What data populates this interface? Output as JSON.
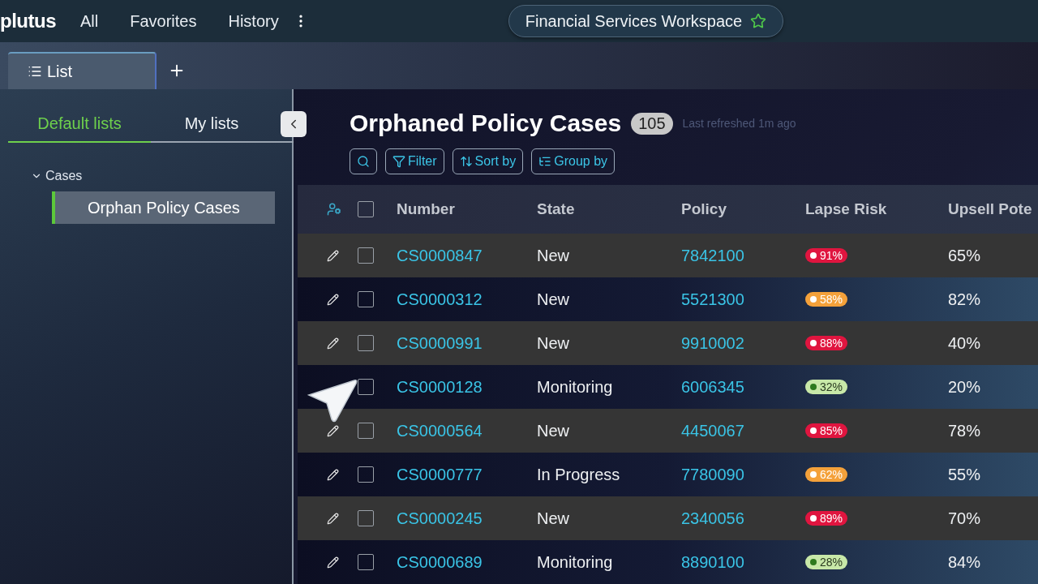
{
  "top_bar": {
    "logo": "plutus",
    "nav": [
      {
        "label": "All"
      },
      {
        "label": "Favorites"
      },
      {
        "label": "History"
      }
    ],
    "workspace": {
      "title": "Financial Services Workspace",
      "favorite": true
    }
  },
  "tabs": [
    {
      "label": "List",
      "selected": true
    }
  ],
  "sidebar": {
    "tabs": [
      {
        "label": "Default lists",
        "selected": true
      },
      {
        "label": "My lists",
        "selected": false
      }
    ],
    "tree": [
      {
        "label": "Cases",
        "expanded": true,
        "selected": false,
        "children": [
          {
            "label": "Orphan Policy Cases",
            "selected": true
          }
        ]
      }
    ]
  },
  "list": {
    "title": "Orphaned Policy Cases",
    "count": "105",
    "refreshed": "Last refreshed 1m ago",
    "toolbar": [
      {
        "kind": "search"
      },
      {
        "kind": "filter",
        "label": "Filter"
      },
      {
        "kind": "sort",
        "label": "Sort by"
      },
      {
        "kind": "group",
        "label": "Group by"
      }
    ]
  },
  "table": {
    "columns": [
      "Number",
      "State",
      "Policy",
      "Lapse Risk",
      "Upsell Pote"
    ],
    "all_checked": false,
    "rows": [
      {
        "number": "CS0000847",
        "state": "New",
        "policy": "7842100",
        "risk": {
          "text": "91%",
          "color": "#e0153f"
        },
        "upsell": "65%",
        "checked": false,
        "edit_icon": true
      },
      {
        "number": "CS0000312",
        "state": "New",
        "policy": "5521300",
        "risk": {
          "text": "58%",
          "color": "#f4a13a"
        },
        "upsell": "82%",
        "checked": false,
        "edit_icon": true
      },
      {
        "number": "CS0000991",
        "state": "New",
        "policy": "9910002",
        "risk": {
          "text": "88%",
          "color": "#e0153f"
        },
        "upsell": "40%",
        "checked": false,
        "edit_icon": true
      },
      {
        "number": "CS0000128",
        "state": "Monitoring",
        "policy": "6006345",
        "risk": {
          "text": "32%",
          "color": "#c8e8a8"
        },
        "upsell": "20%",
        "checked": false,
        "edit_icon": false
      },
      {
        "number": "CS0000564",
        "state": "New",
        "policy": "4450067",
        "risk": {
          "text": "85%",
          "color": "#e0153f"
        },
        "upsell": "78%",
        "checked": false,
        "edit_icon": true
      },
      {
        "number": "CS0000777",
        "state": "In Progress",
        "policy": "7780090",
        "risk": {
          "text": "62%",
          "color": "#f4a13a"
        },
        "upsell": "55%",
        "checked": false,
        "edit_icon": true
      },
      {
        "number": "CS0000245",
        "state": "New",
        "policy": "2340056",
        "risk": {
          "text": "89%",
          "color": "#e0153f"
        },
        "upsell": "70%",
        "checked": false,
        "edit_icon": true
      },
      {
        "number": "CS0000689",
        "state": "Monitoring",
        "policy": "8890100",
        "risk": {
          "text": "28%",
          "color": "#c8e8a8"
        },
        "upsell": "84%",
        "checked": false,
        "edit_icon": true
      }
    ]
  }
}
